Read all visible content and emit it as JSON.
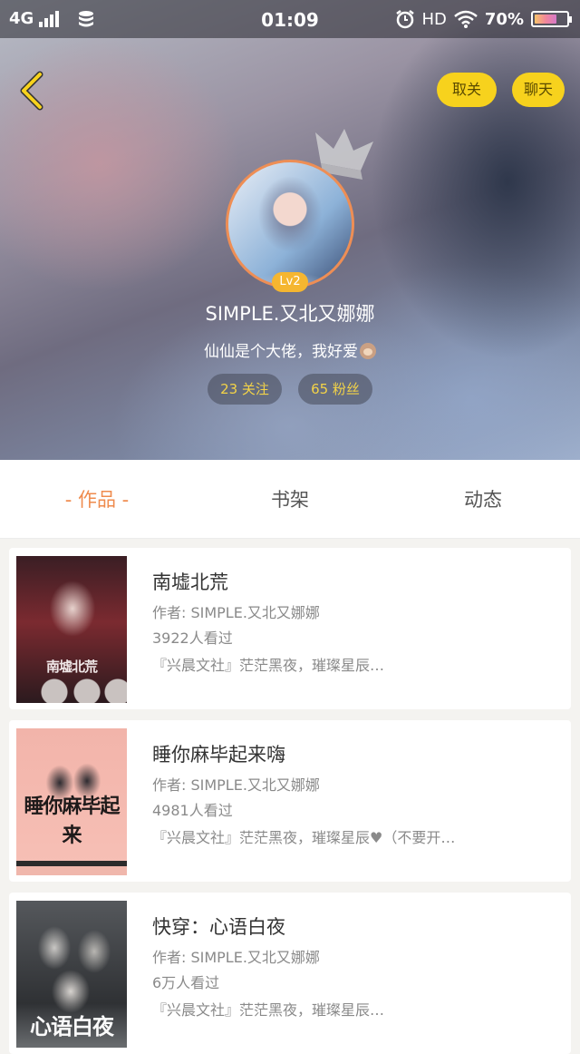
{
  "status_bar": {
    "network": "4G",
    "time": "01:09",
    "hd": "HD",
    "battery_percent": "70%",
    "battery_level": 0.7
  },
  "header": {
    "back_icon": "chevron-left-icon",
    "unfollow_label": "取关",
    "chat_label": "聊天",
    "accent_color": "#f7d21d"
  },
  "profile": {
    "level": "Lv2",
    "username": "SIMPLE.又北又娜娜",
    "bio": "仙仙是个大佬，我好爱",
    "bio_emoji": "monkey-emoji-icon",
    "following": "23 关注",
    "followers": "65 粉丝"
  },
  "tabs": [
    {
      "label": "- 作品 -",
      "active": true
    },
    {
      "label": "书架",
      "active": false
    },
    {
      "label": "动态",
      "active": false
    }
  ],
  "books": [
    {
      "title": "南墟北荒",
      "author": "作者: SIMPLE.又北又娜娜",
      "views": "3922人看过",
      "desc": "『兴晨文社』茫茫黑夜，璀璨星辰…",
      "cover_text": "南墟北荒"
    },
    {
      "title": "睡你麻毕起来嗨",
      "author": "作者: SIMPLE.又北又娜娜",
      "views": "4981人看过",
      "desc": "『兴晨文社』茫茫黑夜，璀璨星辰♥（不要开…",
      "cover_text": "睡你麻毕起来"
    },
    {
      "title": "快穿：心语白夜",
      "author": "作者: SIMPLE.又北又娜娜",
      "views": "6万人看过",
      "desc": "『兴晨文社』茫茫黑夜，璀璨星辰…",
      "cover_text": "心语白夜"
    }
  ]
}
